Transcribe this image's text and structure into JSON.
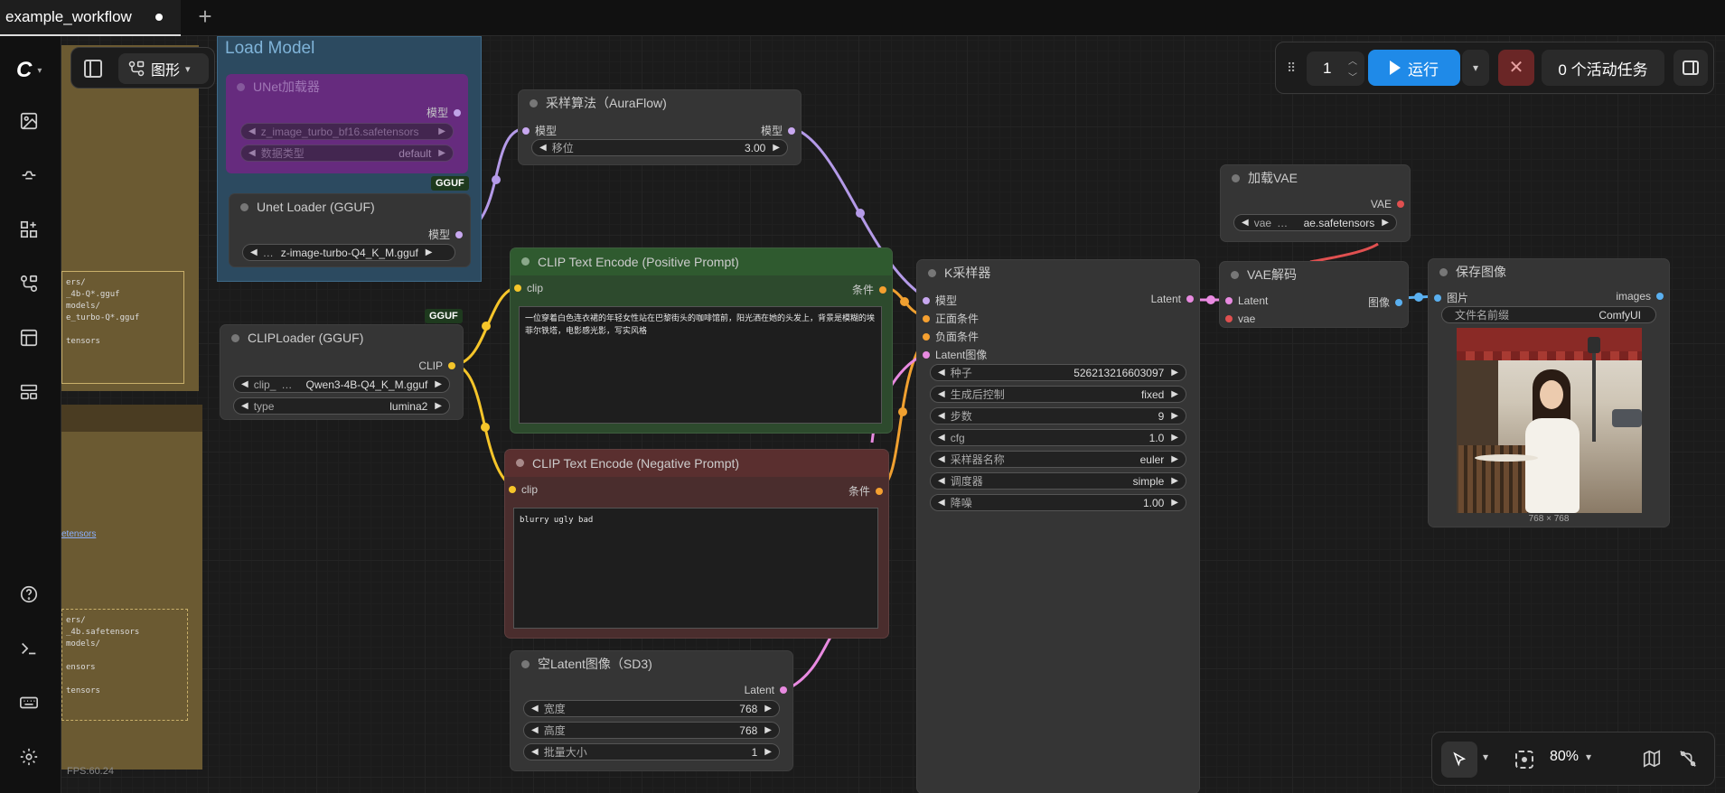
{
  "tab": {
    "title": "example_workflow"
  },
  "view": {
    "mode_label": "图形"
  },
  "group": {
    "title": "Load Model"
  },
  "run": {
    "count": "1",
    "run_label": "运行",
    "tasks_label": "0 个活动任务"
  },
  "zoom": {
    "value": "80%"
  },
  "fps": "FPS:60.24",
  "left_notes": {
    "a": [
      "ers/",
      "_4b-Q*.gguf",
      "models/",
      "e_turbo-Q*.gguf",
      "",
      "tensors"
    ],
    "b": [
      "ers/",
      "_4b.safetensors",
      "models/",
      "",
      "ensors",
      "",
      "tensors"
    ],
    "link": "etensors"
  },
  "nodes": {
    "unet": {
      "title": "UNet加载器",
      "out": "模型",
      "w1": "z_image_turbo_bf16.safetensors",
      "w2_label": "数据类型",
      "w2_value": "default",
      "badge": "GGUF"
    },
    "unet_gguf": {
      "title": "Unet Loader (GGUF)",
      "out": "模型",
      "w1": "z-image-turbo-Q4_K_M.gguf"
    },
    "clip_loader": {
      "title": "CLIPLoader (GGUF)",
      "out": "CLIP",
      "w1_label": "clip_",
      "w1_value": "Qwen3-4B-Q4_K_M.gguf",
      "w2_label": "type",
      "w2_value": "lumina2",
      "badge": "GGUF"
    },
    "aura": {
      "title": "采样算法（AuraFlow)",
      "in": "模型",
      "out": "模型",
      "w_label": "移位",
      "w_value": "3.00"
    },
    "pos": {
      "title": "CLIP Text Encode (Positive Prompt)",
      "in": "clip",
      "out": "条件",
      "text": "一位穿着白色连衣裙的年轻女性站在巴黎街头的咖啡馆前，阳光洒在她的头发上，背景是模糊的埃菲尔铁塔，电影感光影，写实风格"
    },
    "neg": {
      "title": "CLIP Text Encode (Negative Prompt)",
      "in": "clip",
      "out": "条件",
      "text": "blurry ugly bad"
    },
    "latent": {
      "title": "空Latent图像（SD3)",
      "out": "Latent",
      "w": [
        {
          "l": "宽度",
          "v": "768"
        },
        {
          "l": "高度",
          "v": "768"
        },
        {
          "l": "批量大小",
          "v": "1"
        }
      ]
    },
    "ksampler": {
      "title": "K采样器",
      "inputs": [
        "模型",
        "正面条件",
        "负面条件",
        "Latent图像"
      ],
      "out": "Latent",
      "w": [
        {
          "l": "种子",
          "v": "526213216603097"
        },
        {
          "l": "生成后控制",
          "v": "fixed"
        },
        {
          "l": "步数",
          "v": "9"
        },
        {
          "l": "cfg",
          "v": "1.0"
        },
        {
          "l": "采样器名称",
          "v": "euler"
        },
        {
          "l": "调度器",
          "v": "simple"
        },
        {
          "l": "降噪",
          "v": "1.00"
        }
      ]
    },
    "vae_loader": {
      "title": "加载VAE",
      "out": "VAE",
      "w_label": "vae",
      "w_value": "ae.safetensors"
    },
    "vae_decode": {
      "title": "VAE解码",
      "in1": "Latent",
      "in2": "vae",
      "out": "图像"
    },
    "save": {
      "title": "保存图像",
      "in": "图片",
      "out": "images",
      "w_label": "文件名前缀",
      "w_value": "ComfyUI",
      "size": "768 × 768"
    }
  }
}
